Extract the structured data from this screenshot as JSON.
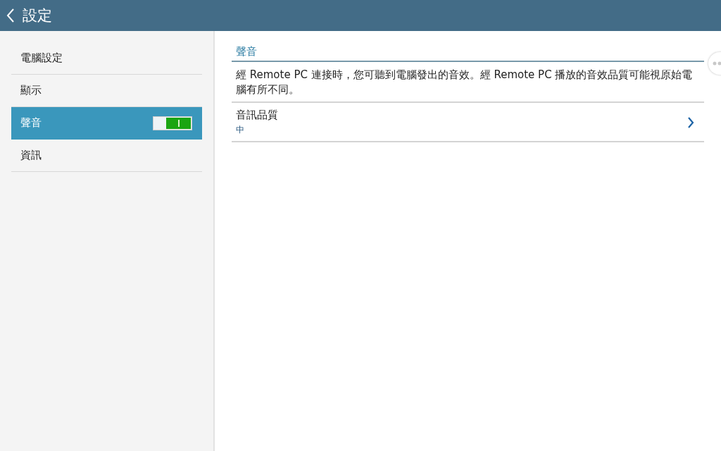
{
  "header": {
    "title": "設定"
  },
  "sidebar": {
    "items": [
      {
        "label": "電腦設定",
        "selected": false
      },
      {
        "label": "顯示",
        "selected": false
      },
      {
        "label": "聲音",
        "selected": true,
        "toggle": {
          "on": true
        }
      },
      {
        "label": "資訊",
        "selected": false
      }
    ]
  },
  "content": {
    "section_title": "聲音",
    "description": "經 Remote PC 連接時，您可聽到電腦發出的音效。經 Remote PC 播放的音效品質可能視原始電腦有所不同。",
    "settings": [
      {
        "label": "音訊品質",
        "value": "中"
      }
    ]
  }
}
